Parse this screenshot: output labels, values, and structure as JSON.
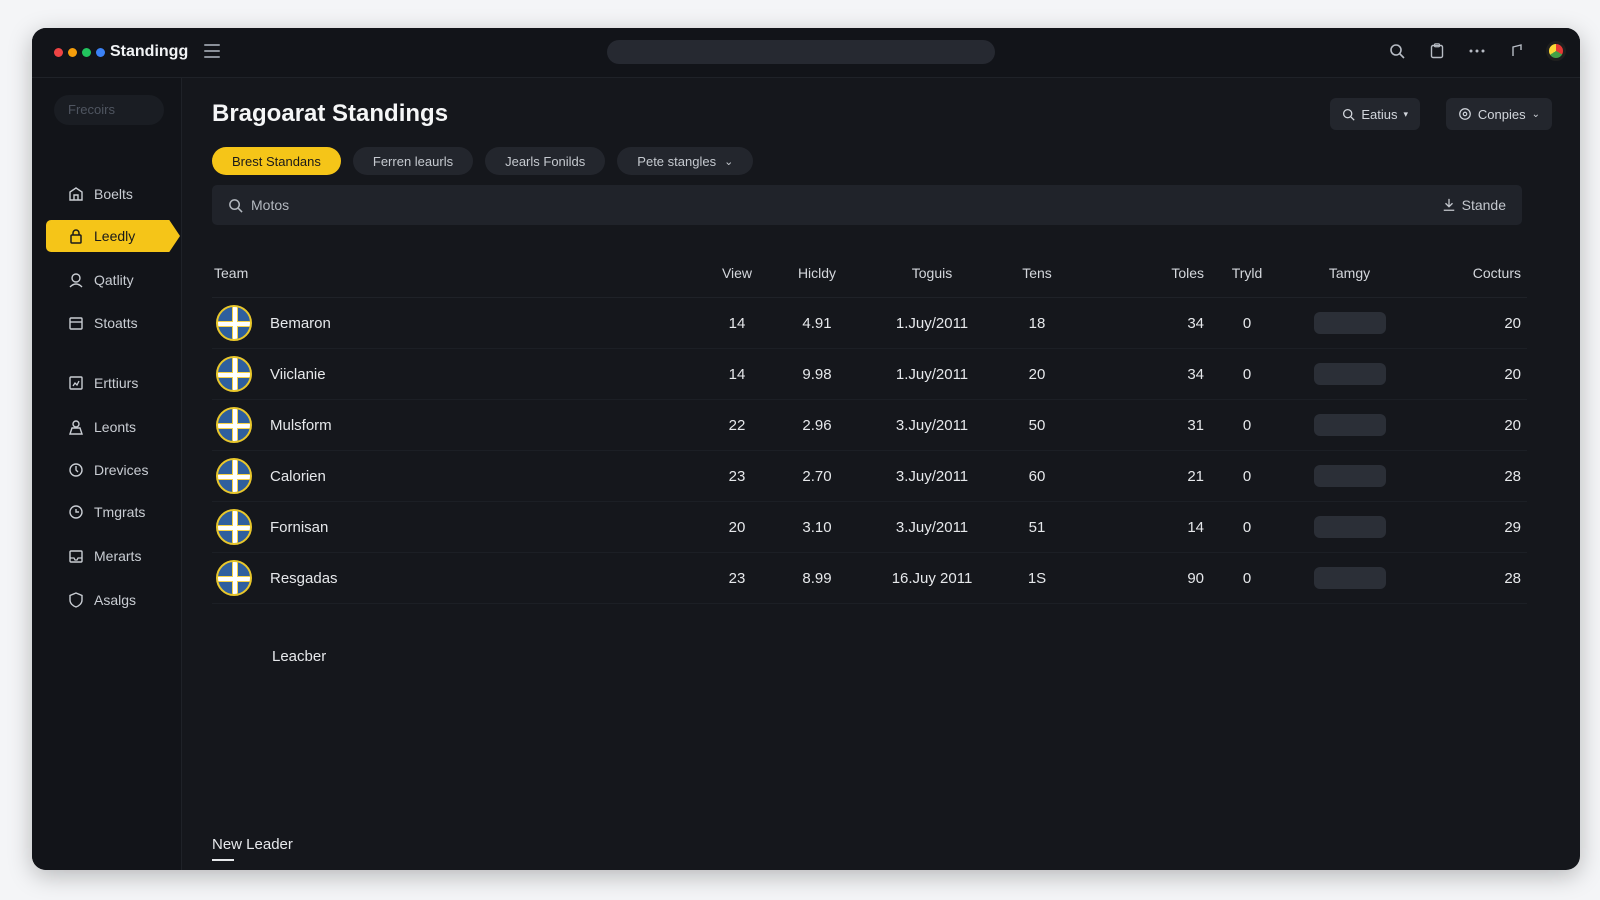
{
  "app": {
    "title": "Standingg",
    "window_dots": [
      "#ef4444",
      "#f59e0b",
      "#22c55e",
      "#3b82f6"
    ],
    "accent": "#f5c518"
  },
  "sidebar": {
    "search_placeholder": "Frecoirs",
    "items": [
      {
        "label": "Boelts",
        "icon": "home-icon"
      },
      {
        "label": "Leedly",
        "icon": "lock-icon",
        "active": true
      },
      {
        "label": "Qatlity",
        "icon": "user-icon"
      },
      {
        "label": "Stoatts",
        "icon": "calendar-icon"
      },
      {
        "label": "Erttiurs",
        "icon": "chart-icon"
      },
      {
        "label": "Leonts",
        "icon": "people-icon"
      },
      {
        "label": "Drevices",
        "icon": "clock-icon"
      },
      {
        "label": "Tmgrats",
        "icon": "history-icon"
      },
      {
        "label": "Merarts",
        "icon": "inbox-icon"
      },
      {
        "label": "Asalgs",
        "icon": "shield-icon"
      }
    ]
  },
  "header": {
    "title": "Bragoarat Standings",
    "btn_editors": "Eatius",
    "btn_compare": "Conpies"
  },
  "chips": [
    {
      "label": "Brest Standans",
      "active": true
    },
    {
      "label": "Ferren leaurls"
    },
    {
      "label": "Jearls Fonilds"
    },
    {
      "label": "Pete stangles",
      "dropdown": true
    }
  ],
  "filter": {
    "query": "Motos",
    "action": "Stande"
  },
  "table": {
    "columns": [
      "Team",
      "View",
      "Hicldy",
      "Toguis",
      "Tens",
      "Toles",
      "Tryld",
      "Tamgy",
      "Cocturs"
    ],
    "rows": [
      {
        "team": "Bemaron",
        "view": "14",
        "hicldy": "4.91",
        "toguis": "1.Juy/2011",
        "tens": "18",
        "toles": "34",
        "tryld": "0",
        "cocturs": "20"
      },
      {
        "team": "Viiclanie",
        "view": "14",
        "hicldy": "9.98",
        "toguis": "1.Juy/2011",
        "tens": "20",
        "toles": "34",
        "tryld": "0",
        "cocturs": "20"
      },
      {
        "team": "Mulsform",
        "view": "22",
        "hicldy": "2.96",
        "toguis": "3.Juy/2011",
        "tens": "50",
        "toles": "31",
        "tryld": "0",
        "cocturs": "20"
      },
      {
        "team": "Calorien",
        "view": "23",
        "hicldy": "2.70",
        "toguis": "3.Juy/2011",
        "tens": "60",
        "toles": "21",
        "tryld": "0",
        "cocturs": "28"
      },
      {
        "team": "Fornisan",
        "view": "20",
        "hicldy": "3.10",
        "toguis": "3.Juy/2011",
        "tens": "51",
        "toles": "14",
        "tryld": "0",
        "cocturs": "29"
      },
      {
        "team": "Resgadas",
        "view": "23",
        "hicldy": "8.99",
        "toguis": "16.Juy 2011",
        "tens": "1S",
        "toles": "90",
        "tryld": "0",
        "cocturs": "28"
      }
    ],
    "leader_label": "Leacber"
  },
  "footer": {
    "tab": "New Leader"
  }
}
